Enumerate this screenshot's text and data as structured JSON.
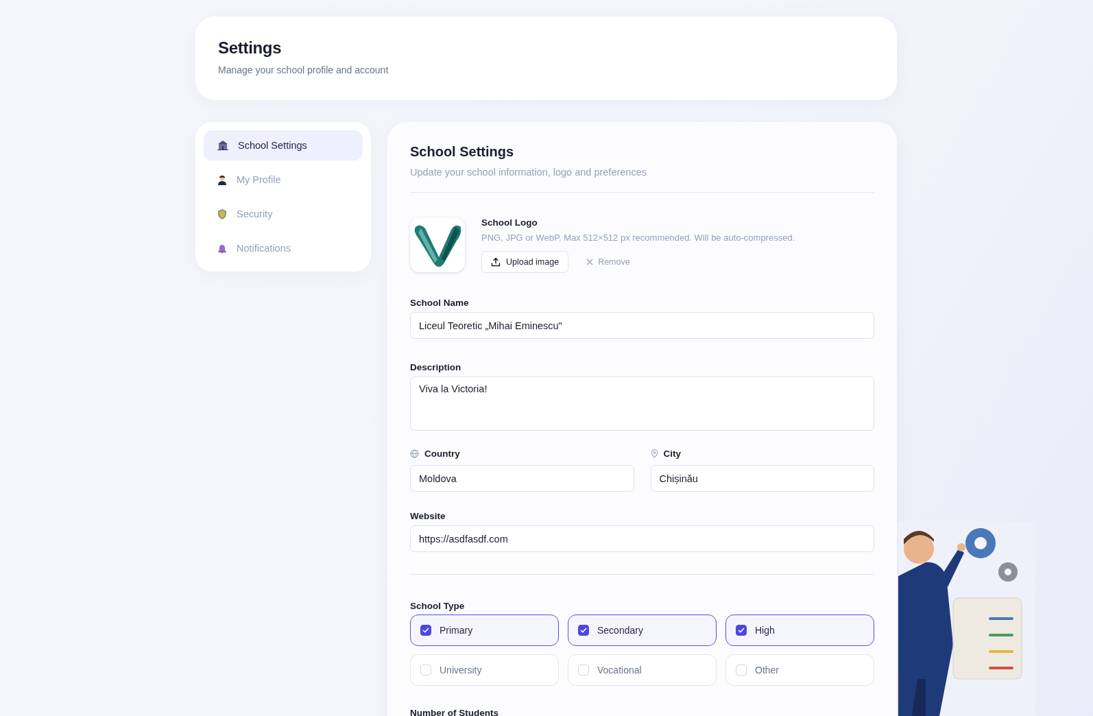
{
  "header": {
    "title": "Settings",
    "subtitle": "Manage your school profile and account"
  },
  "sidebar": {
    "items": [
      {
        "label": "School Settings",
        "selected": true
      },
      {
        "label": "My Profile",
        "selected": false
      },
      {
        "label": "Security",
        "selected": false
      },
      {
        "label": "Notifications",
        "selected": false
      }
    ]
  },
  "main": {
    "title": "School Settings",
    "subtitle": "Update your school information, logo and preferences",
    "logo": {
      "label": "School Logo",
      "hint": "PNG, JPG or WebP. Max 512×512 px recommended. Will be auto-compressed.",
      "upload_button": "Upload image",
      "remove_button": "Remove"
    },
    "school_name": {
      "label": "School Name",
      "value": "Liceul Teoretic „Mihai Eminescu\""
    },
    "description": {
      "label": "Description",
      "value": "Viva la Victoria!"
    },
    "country": {
      "label": "Country",
      "value": "Moldova"
    },
    "city": {
      "label": "City",
      "value": "Chișinău"
    },
    "website": {
      "label": "Website",
      "value": "https://asdfasdf.com"
    },
    "school_type": {
      "label": "School Type",
      "options": [
        {
          "label": "Primary",
          "checked": true
        },
        {
          "label": "Secondary",
          "checked": true
        },
        {
          "label": "High",
          "checked": true
        },
        {
          "label": "University",
          "checked": false
        },
        {
          "label": "Vocational",
          "checked": false
        },
        {
          "label": "Other",
          "checked": false
        }
      ]
    },
    "students": {
      "label": "Number of Students"
    }
  }
}
